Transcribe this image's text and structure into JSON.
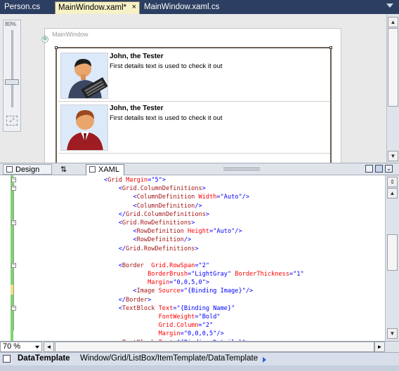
{
  "tabs": [
    {
      "label": "Person.cs",
      "active": false
    },
    {
      "label": "MainWindow.xaml*",
      "active": true
    },
    {
      "label": "MainWindow.xaml.cs",
      "active": false
    }
  ],
  "tab_close_glyph": "×",
  "designer": {
    "zoom_slider_label": "80%",
    "window_title": "MainWindow",
    "items": [
      {
        "name": "John, the Tester",
        "details": "First details text is used to check it out",
        "shirt": "#3b4660"
      },
      {
        "name": "John, the Tester",
        "details": "First details text is used to check it out",
        "shirt": "#9e1c22"
      }
    ]
  },
  "view_switcher": {
    "design_label": "Design",
    "swap_label": "⇅",
    "xaml_label": "XAML"
  },
  "code_lines": [
    [
      [
        "ang",
        "<"
      ],
      [
        "tag",
        "Grid"
      ],
      [
        "attr",
        " Margin"
      ],
      [
        "ang",
        "=\""
      ],
      [
        "val",
        "5"
      ],
      [
        "ang",
        "\">"
      ]
    ],
    [
      [
        "ang",
        "    <"
      ],
      [
        "tag",
        "Grid.ColumnDefinitions"
      ],
      [
        "ang",
        ">"
      ]
    ],
    [
      [
        "ang",
        "        <"
      ],
      [
        "tag",
        "ColumnDefinition"
      ],
      [
        "attr",
        " Width"
      ],
      [
        "ang",
        "=\""
      ],
      [
        "val",
        "Auto"
      ],
      [
        "ang",
        "\"/>"
      ]
    ],
    [
      [
        "ang",
        "        <"
      ],
      [
        "tag",
        "ColumnDefinition"
      ],
      [
        "ang",
        "/>"
      ]
    ],
    [
      [
        "ang",
        "    </"
      ],
      [
        "tag",
        "Grid.ColumnDefinitions"
      ],
      [
        "ang",
        ">"
      ]
    ],
    [
      [
        "ang",
        "    <"
      ],
      [
        "tag",
        "Grid.RowDefinitions"
      ],
      [
        "ang",
        ">"
      ]
    ],
    [
      [
        "ang",
        "        <"
      ],
      [
        "tag",
        "RowDefinition"
      ],
      [
        "attr",
        " Height"
      ],
      [
        "ang",
        "=\""
      ],
      [
        "val",
        "Auto"
      ],
      [
        "ang",
        "\"/>"
      ]
    ],
    [
      [
        "ang",
        "        <"
      ],
      [
        "tag",
        "RowDefinition"
      ],
      [
        "ang",
        "/>"
      ]
    ],
    [
      [
        "ang",
        "    </"
      ],
      [
        "tag",
        "Grid.RowDefinitions"
      ],
      [
        "ang",
        ">"
      ]
    ],
    [
      [
        "ang",
        ""
      ]
    ],
    [
      [
        "ang",
        "    <"
      ],
      [
        "tag",
        "Border"
      ],
      [
        "attr",
        "  Grid.RowSpan"
      ],
      [
        "ang",
        "=\""
      ],
      [
        "val",
        "2"
      ],
      [
        "ang",
        "\""
      ]
    ],
    [
      [
        "attr",
        "            BorderBrush"
      ],
      [
        "ang",
        "=\""
      ],
      [
        "val",
        "LightGray"
      ],
      [
        "ang",
        "\""
      ],
      [
        "attr",
        " BorderThickness"
      ],
      [
        "ang",
        "=\""
      ],
      [
        "val",
        "1"
      ],
      [
        "ang",
        "\""
      ]
    ],
    [
      [
        "attr",
        "            Margin"
      ],
      [
        "ang",
        "=\""
      ],
      [
        "val",
        "0,0,5,0"
      ],
      [
        "ang",
        "\">"
      ]
    ],
    [
      [
        "ang",
        "        <"
      ],
      [
        "tag",
        "Image"
      ],
      [
        "attr",
        " Source"
      ],
      [
        "ang",
        "=\""
      ],
      [
        "val",
        "{Binding Image}"
      ],
      [
        "ang",
        "\"/>"
      ]
    ],
    [
      [
        "ang",
        "    </"
      ],
      [
        "tag",
        "Border"
      ],
      [
        "ang",
        ">"
      ]
    ],
    [
      [
        "ang",
        "    <"
      ],
      [
        "tag",
        "TextBlock"
      ],
      [
        "attr",
        " Text"
      ],
      [
        "ang",
        "=\""
      ],
      [
        "val",
        "{Binding Name}"
      ],
      [
        "ang",
        "\""
      ]
    ],
    [
      [
        "attr",
        "               FontWeight"
      ],
      [
        "ang",
        "=\""
      ],
      [
        "val",
        "Bold"
      ],
      [
        "ang",
        "\""
      ]
    ],
    [
      [
        "attr",
        "               Grid.Column"
      ],
      [
        "ang",
        "=\""
      ],
      [
        "val",
        "2"
      ],
      [
        "ang",
        "\""
      ]
    ],
    [
      [
        "attr",
        "               Margin"
      ],
      [
        "ang",
        "=\""
      ],
      [
        "val",
        "0,0,0,5"
      ],
      [
        "ang",
        "\"/>"
      ]
    ],
    [
      [
        "ang",
        "    <"
      ],
      [
        "tag",
        "TextBlock"
      ],
      [
        "attr",
        " Text"
      ],
      [
        "ang",
        "=\""
      ],
      [
        "val",
        "{Binding Details}"
      ],
      [
        "ang",
        "\""
      ]
    ]
  ],
  "zoom_combo": "70 %",
  "breadcrumb": {
    "root": "DataTemplate",
    "path": "Window/Grid/ListBox/ItemTemplate/DataTemplate"
  }
}
